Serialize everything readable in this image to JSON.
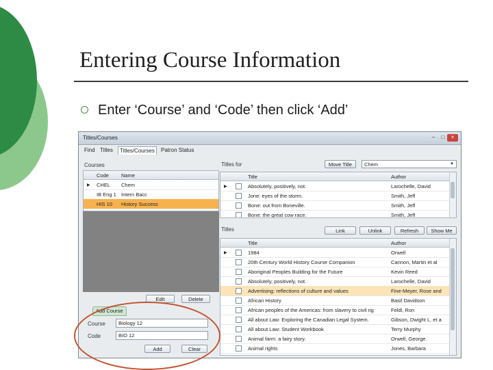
{
  "slide": {
    "title": "Entering Course Information",
    "bullet": "Enter ‘Course’ and ‘Code’ then click ‘Add’"
  },
  "colors": {
    "accent_green": "#2e8b46",
    "light_green": "#7fbf7f",
    "selection": "#f7b24f",
    "annotation": "#c0532f"
  },
  "window": {
    "title": "Titles/Courses",
    "minimize_icon": "minimize-icon",
    "maximize_icon": "maximize-icon",
    "close_label": "×",
    "menu": [
      "Find",
      "Titles",
      "Titles/Courses",
      "Patron Status"
    ],
    "courses_label": "Courses",
    "courses_columns": [
      "Code",
      "Name"
    ],
    "courses_rows": [
      {
        "code": "CHEL",
        "name": "Chem"
      },
      {
        "code": "IB Eng 1",
        "name": "Intern Bacc"
      },
      {
        "code": "HIS 10",
        "name": "History Success"
      }
    ],
    "edit_label": "Edit",
    "delete_label": "Delete",
    "add_course_tab": "Add Course",
    "course_field_label": "Course",
    "course_value": "Biology 12",
    "code_field_label": "Code",
    "code_value": "BIO 12",
    "add_label": "Add",
    "clear_label": "Clear",
    "titles_for_label": "Titles for",
    "move_title_label": "Move Title",
    "course_select_value": "Chem",
    "titles_for_columns": [
      "Title",
      "Author"
    ],
    "titles_for_rows": [
      {
        "title": "Absolutely, positively, not.",
        "author": "Larochelle, David"
      },
      {
        "title": "Jone: eyes of the storm.",
        "author": "Smith, Jeff"
      },
      {
        "title": "Bone: out from Boneville.",
        "author": "Smith, Jeff"
      },
      {
        "title": "Bone: the great cow race.",
        "author": "Smith, Jeff"
      }
    ],
    "titles_label": "Titles",
    "link_label": "Link",
    "unlink_label": "Unlink",
    "refresh_label": "Refresh",
    "show_me_label": "Show Me",
    "titles_columns": [
      "Title",
      "Author"
    ],
    "titles_rows": [
      {
        "title": "1984",
        "author": "Orwell"
      },
      {
        "title": "20th Century World History Course Companion",
        "author": "Cannon, Martin et al"
      },
      {
        "title": "Aboriginal Peoples Building for the Future",
        "author": "Kevin Reed"
      },
      {
        "title": "Absolutely, positively, not.",
        "author": "Larochelle, David"
      },
      {
        "title": "Advertising: reflections of culture and values",
        "author": "Fine-Meyer, Rose and"
      },
      {
        "title": "African History",
        "author": "Basil Davidson"
      },
      {
        "title": "African peoples of the Americas: from slavery to civil rig",
        "author": "Feldl, Ron"
      },
      {
        "title": "All about Law: Exploring the Canadian Legal System.",
        "author": "Gibson, Dwight L. et a"
      },
      {
        "title": "All about Law: Student Workbook",
        "author": "Terry Murphy"
      },
      {
        "title": "Animal farm: a fairy story.",
        "author": "Orwell, George."
      },
      {
        "title": "Animal rights",
        "author": "Jones, Barbara"
      }
    ]
  }
}
